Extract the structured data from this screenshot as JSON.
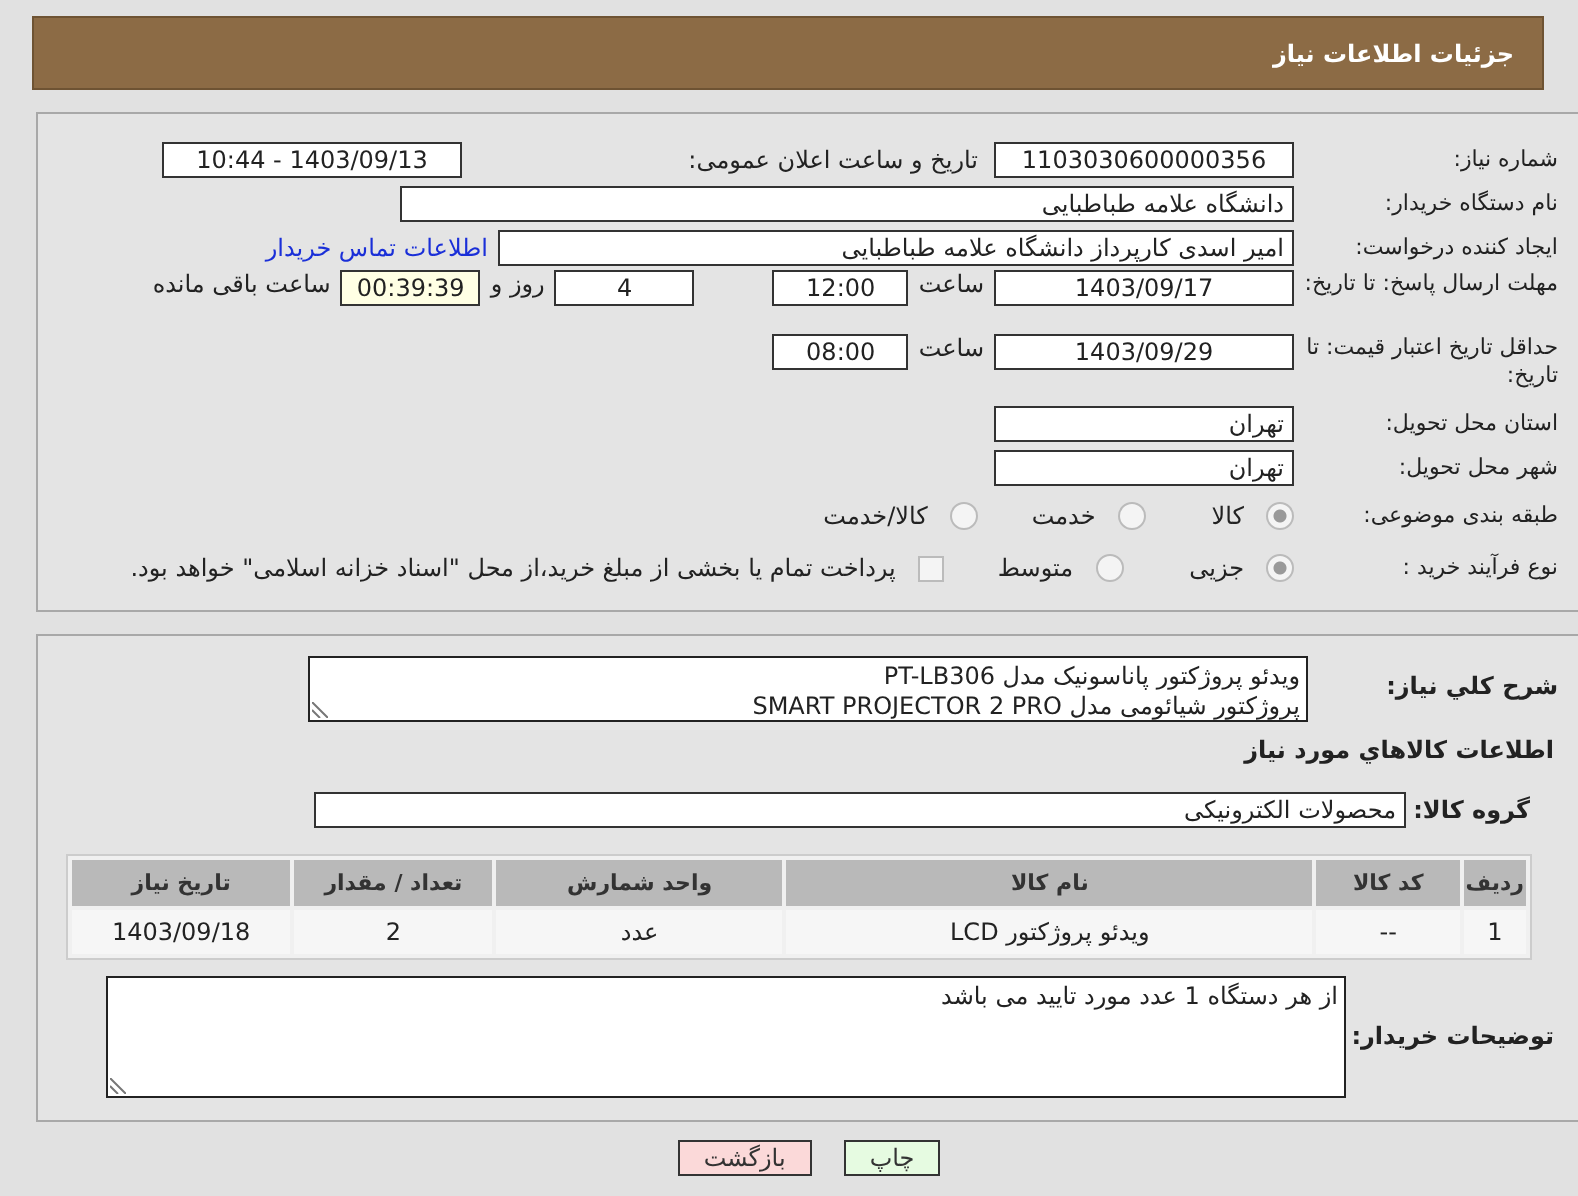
{
  "header": {
    "title": "جزئیات اطلاعات نیاز"
  },
  "need_number": {
    "label": "شماره نیاز:",
    "value": "1103030600000356"
  },
  "announce": {
    "label": "تاریخ و ساعت اعلان عمومی:",
    "value": "1403/09/13 - 10:44"
  },
  "buyer_org": {
    "label": "نام دستگاه خریدار:",
    "value": "دانشگاه علامه طباطبایی"
  },
  "requester": {
    "label": "ایجاد کننده درخواست:",
    "value": "امیر اسدی کارپرداز دانشگاه علامه طباطبایی",
    "link": "اطلاعات تماس خریدار"
  },
  "reply_deadline": {
    "label": "مهلت ارسال پاسخ: تا تاریخ:",
    "date": "1403/09/17",
    "time_label": "ساعت",
    "time": "12:00",
    "days": "4",
    "days_label": "روز و",
    "remaining": "00:39:39",
    "remaining_label": "ساعت باقی مانده"
  },
  "price_validity": {
    "label": "حداقل تاریخ اعتبار قیمت: تا تاریخ:",
    "date": "1403/09/29",
    "time_label": "ساعت",
    "time": "08:00"
  },
  "province": {
    "label": "استان محل تحویل:",
    "value": "تهران"
  },
  "city": {
    "label": "شهر محل تحویل:",
    "value": "تهران"
  },
  "category": {
    "label": "طبقه بندی موضوعی:",
    "options": [
      {
        "label": "کالا",
        "selected": true
      },
      {
        "label": "خدمت",
        "selected": false
      },
      {
        "label": "کالا/خدمت",
        "selected": false
      }
    ]
  },
  "process": {
    "label": "نوع فرآیند خرید :",
    "options": [
      {
        "label": "جزیی",
        "selected": true
      },
      {
        "label": "متوسط",
        "selected": false
      }
    ],
    "payment": {
      "label": "پرداخت تمام یا بخشی از مبلغ خرید،از محل \"اسناد خزانه اسلامی\" خواهد بود.",
      "checked": false
    }
  },
  "description": {
    "label": "شرح کلي نياز:",
    "lines": [
      "ویدئو پروژکتور پاناسونیک مدل PT-LB306",
      "پروژکتور شیائومی مدل SMART PROJECTOR 2 PRO"
    ]
  },
  "items_title": "اطلاعات كالاهاي مورد نياز",
  "group": {
    "label": "گروه کالا:",
    "value": "محصولات الکترونیکی"
  },
  "table": {
    "columns": [
      "ردیف",
      "کد کالا",
      "نام کالا",
      "واحد شمارش",
      "تعداد / مقدار",
      "تاریخ نیاز"
    ],
    "rows": [
      [
        "1",
        "--",
        "ویدئو پروژکتور LCD",
        "عدد",
        "2",
        "1403/09/18"
      ]
    ]
  },
  "notes": {
    "label": "توضیحات خریدار:",
    "value": "از هر دستگاه 1 عدد مورد تایید می باشد"
  },
  "buttons": [
    {
      "label": "چاپ",
      "kind": "print"
    },
    {
      "label": "بازگشت",
      "kind": "back"
    }
  ]
}
